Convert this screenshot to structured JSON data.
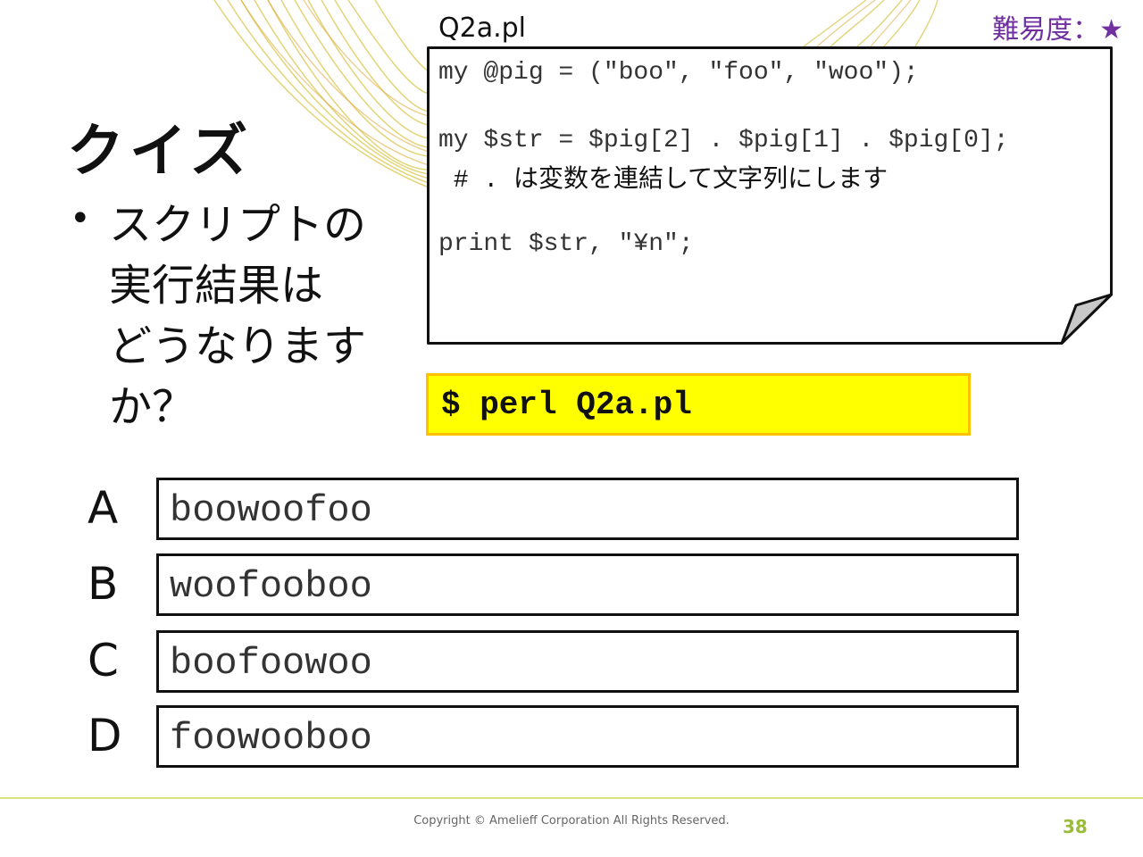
{
  "difficulty": "難易度：★",
  "title": "クイズ",
  "question": {
    "bullet": "•",
    "lines": [
      "スクリプトの",
      "実行結果は",
      "どうなります",
      "か？"
    ]
  },
  "script": {
    "filename": "Q2a.pl",
    "code_lines": [
      "my @pig = (\"boo\", \"foo\", \"woo\");",
      "my $str = $pig[2] . $pig[1] . $pig[0];",
      "print $str, \"¥n\";"
    ],
    "comment_prefix": " # . ",
    "comment_text": "は変数を連結して文字列にします"
  },
  "command": "$ perl Q2a.pl",
  "options": [
    {
      "letter": "A",
      "text": "boowoofoo"
    },
    {
      "letter": "B",
      "text": "woofooboo"
    },
    {
      "letter": "C",
      "text": "boofoowoo"
    },
    {
      "letter": "D",
      "text": "foowooboo"
    }
  ],
  "footer": {
    "copyright": "Copyright © Amelieff Corporation All Rights Reserved.",
    "page_number": "38"
  },
  "colors": {
    "accent_yellow": "#ffff00",
    "border_orange": "#ffc000",
    "difficulty_purple": "#7030a0",
    "footer_green": "#9bbb3b"
  }
}
